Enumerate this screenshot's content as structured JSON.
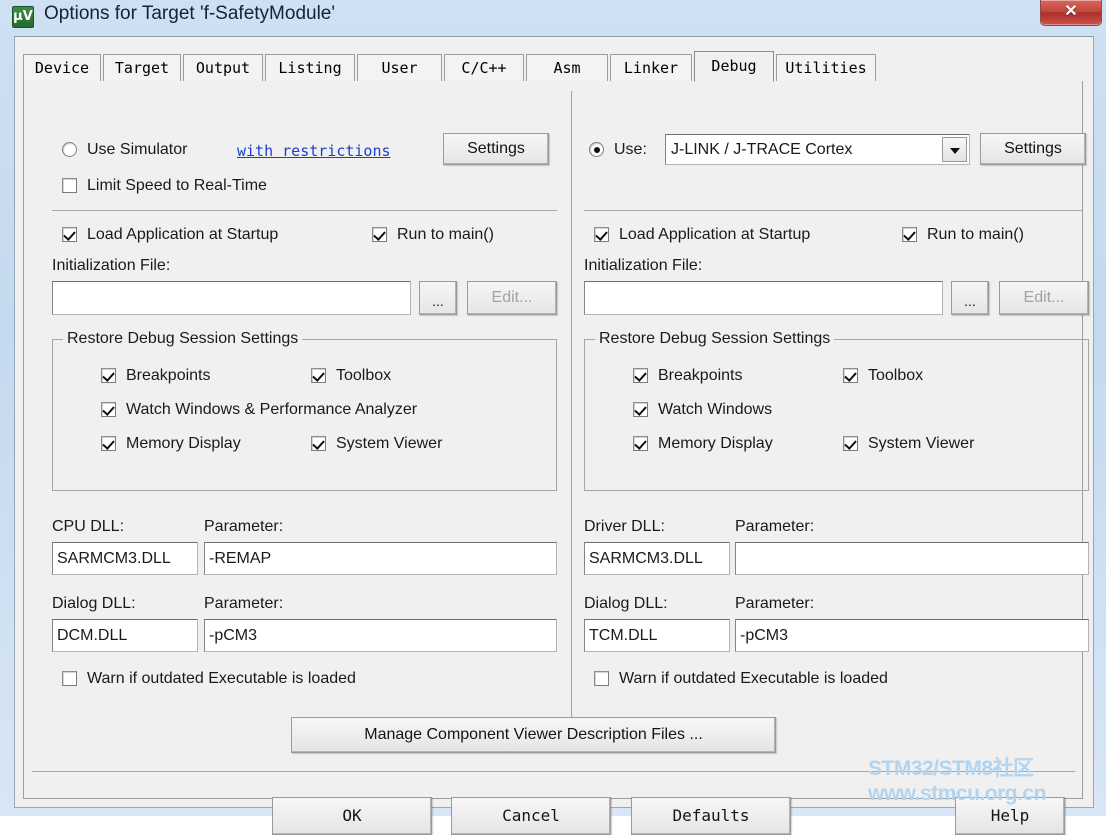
{
  "window": {
    "title": "Options for Target 'f-SafetyModule'",
    "app_icon": "uvision-icon",
    "close_label": "✕"
  },
  "tabs": [
    {
      "label": "Device",
      "active": false
    },
    {
      "label": "Target",
      "active": false
    },
    {
      "label": "Output",
      "active": false
    },
    {
      "label": "Listing",
      "active": false
    },
    {
      "label": "User",
      "active": false
    },
    {
      "label": "C/C++",
      "active": false
    },
    {
      "label": "Asm",
      "active": false
    },
    {
      "label": "Linker",
      "active": false
    },
    {
      "label": "Debug",
      "active": true
    },
    {
      "label": "Utilities",
      "active": false
    }
  ],
  "left": {
    "use_simulator_label": "Use Simulator",
    "use_simulator_checked": false,
    "with_restrictions_link": "with restrictions",
    "settings_button": "Settings",
    "limit_speed_label": "Limit Speed to Real-Time",
    "limit_speed_checked": false,
    "load_app_label": "Load Application at Startup",
    "load_app_checked": true,
    "run_to_main_label": "Run to main()",
    "run_to_main_checked": true,
    "init_file_label": "Initialization File:",
    "init_file_value": "",
    "browse_button": "...",
    "edit_button": "Edit...",
    "edit_disabled": true,
    "restore_group_title": "Restore Debug Session Settings",
    "restore_items": [
      {
        "label": "Breakpoints",
        "checked": true
      },
      {
        "label": "Toolbox",
        "checked": true
      },
      {
        "label": "Watch Windows & Performance Analyzer",
        "checked": true
      },
      {
        "label": "Memory Display",
        "checked": true
      },
      {
        "label": "System Viewer",
        "checked": true
      }
    ],
    "cpu_dll_label": "CPU DLL:",
    "cpu_dll_value": "SARMCM3.DLL",
    "cpu_param_label": "Parameter:",
    "cpu_param_value": "-REMAP",
    "dialog_dll_label": "Dialog DLL:",
    "dialog_dll_value": "DCM.DLL",
    "dialog_param_label": "Parameter:",
    "dialog_param_value": "-pCM3",
    "warn_outdated_label": "Warn if outdated Executable is loaded",
    "warn_outdated_checked": false
  },
  "right": {
    "use_radio_label": "Use:",
    "use_radio_checked": true,
    "driver_combo_value": "J-LINK / J-TRACE Cortex",
    "settings_button": "Settings",
    "load_app_label": "Load Application at Startup",
    "load_app_checked": true,
    "run_to_main_label": "Run to main()",
    "run_to_main_checked": true,
    "init_file_label": "Initialization File:",
    "init_file_value": "",
    "browse_button": "...",
    "edit_button": "Edit...",
    "edit_disabled": true,
    "restore_group_title": "Restore Debug Session Settings",
    "restore_items": [
      {
        "label": "Breakpoints",
        "checked": true
      },
      {
        "label": "Toolbox",
        "checked": true
      },
      {
        "label": "Watch Windows",
        "checked": true
      },
      {
        "label": "Memory Display",
        "checked": true
      },
      {
        "label": "System Viewer",
        "checked": true
      }
    ],
    "driver_dll_label": "Driver DLL:",
    "driver_dll_value": "SARMCM3.DLL",
    "driver_param_label": "Parameter:",
    "driver_param_value": "",
    "dialog_dll_label": "Dialog DLL:",
    "dialog_dll_value": "TCM.DLL",
    "dialog_param_label": "Parameter:",
    "dialog_param_value": "-pCM3",
    "warn_outdated_label": "Warn if outdated Executable is loaded",
    "warn_outdated_checked": false
  },
  "manage_button": "Manage Component Viewer Description Files ...",
  "footer": {
    "ok": "OK",
    "cancel": "Cancel",
    "defaults": "Defaults",
    "help": "Help"
  },
  "watermark": {
    "line1": "STM32/STM8社区",
    "line2": "www.stmcu.org.cn",
    "color": "#b3d4ee"
  }
}
